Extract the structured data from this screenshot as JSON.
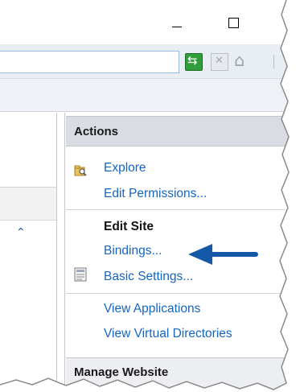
{
  "window": {
    "minimize_icon": "minimize-icon",
    "maximize_icon": "maximize-icon"
  },
  "toolbar": {
    "address_value": "",
    "icons": [
      "go-refresh-icon",
      "stop-icon",
      "home-icon"
    ]
  },
  "actions_panel": {
    "header": "Actions",
    "explore": "Explore",
    "edit_permissions": "Edit Permissions...",
    "edit_site_title": "Edit Site",
    "bindings": "Bindings...",
    "basic_settings": "Basic Settings...",
    "view_applications": "View Applications",
    "view_virtual_directories": "View Virtual Directories",
    "manage_website": "Manage Website"
  },
  "colors": {
    "link": "#1565c0",
    "annotation_arrow": "#1458a8",
    "header_bg": "#d9dde3"
  }
}
